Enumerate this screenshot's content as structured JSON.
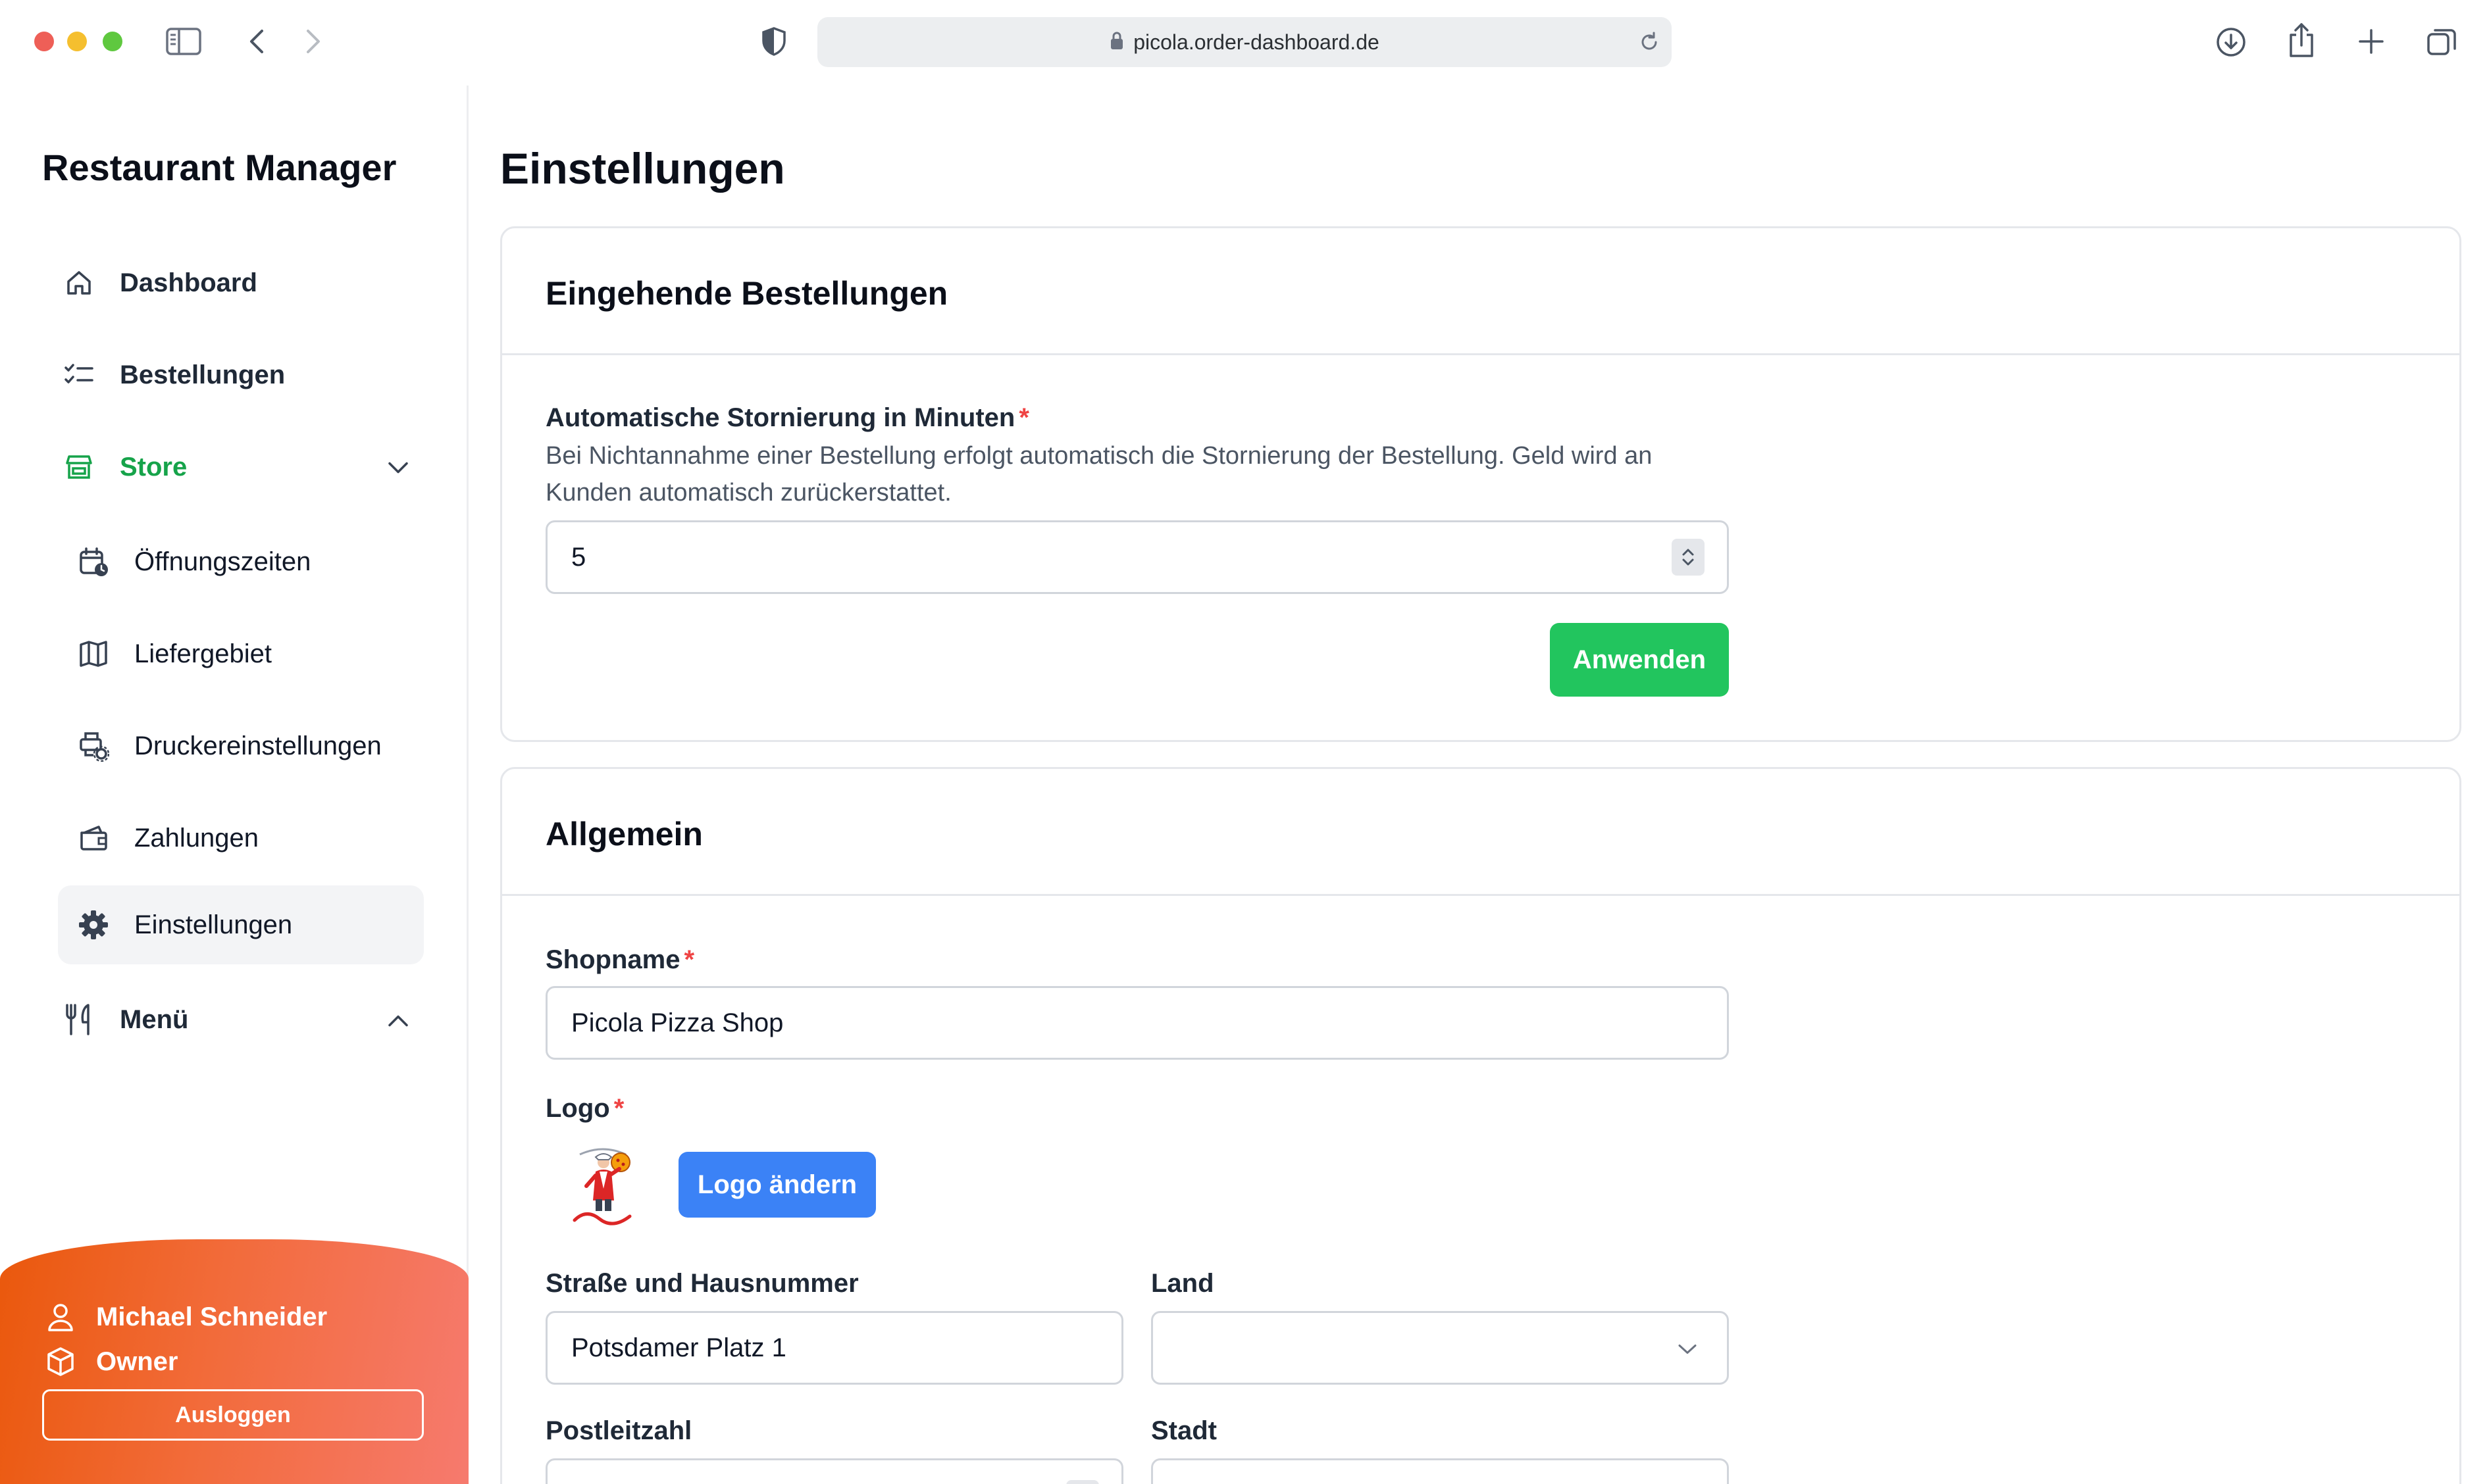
{
  "browser": {
    "url": "picola.order-dashboard.de"
  },
  "sidebar": {
    "app_title": "Restaurant Manager",
    "items": [
      {
        "label": "Dashboard",
        "icon": "home-icon"
      },
      {
        "label": "Bestellungen",
        "icon": "checklist-icon"
      },
      {
        "label": "Store",
        "icon": "store-icon",
        "expanded": true
      },
      {
        "label": "Öffnungszeiten",
        "icon": "calendar-clock-icon"
      },
      {
        "label": "Liefergebiet",
        "icon": "map-icon"
      },
      {
        "label": "Druckereinstellungen",
        "icon": "printer-settings-icon"
      },
      {
        "label": "Zahlungen",
        "icon": "wallet-icon"
      },
      {
        "label": "Einstellungen",
        "icon": "gear-icon",
        "active": true
      },
      {
        "label": "Menü",
        "icon": "fork-knife-icon",
        "expanded": false
      }
    ],
    "user": {
      "name": "Michael Schneider",
      "role": "Owner",
      "logout_label": "Ausloggen"
    }
  },
  "main": {
    "page_title": "Einstellungen",
    "orders_card": {
      "title": "Eingehende Bestellungen",
      "auto_cancel_label": "Automatische Stornierung in Minuten",
      "auto_cancel_help": "Bei Nichtannahme einer Bestellung erfolgt automatisch die Stornierung der Bestellung. Geld wird an Kunden automatisch zurückerstattet.",
      "auto_cancel_value": "5",
      "apply_label": "Anwenden"
    },
    "general_card": {
      "title": "Allgemein",
      "shopname_label": "Shopname",
      "shopname_value": "Picola Pizza Shop",
      "logo_label": "Logo",
      "logo_button": "Logo ändern",
      "street_label": "Straße und Hausnummer",
      "street_value": "Potsdamer Platz 1",
      "country_label": "Land",
      "country_value": "",
      "zip_label": "Postleitzahl",
      "city_label": "Stadt"
    }
  },
  "colors": {
    "accent_green": "#22c55e",
    "store_green": "#16a34a",
    "button_blue": "#3b82f6",
    "required_red": "#ef4444",
    "user_panel": "#ea580c"
  }
}
